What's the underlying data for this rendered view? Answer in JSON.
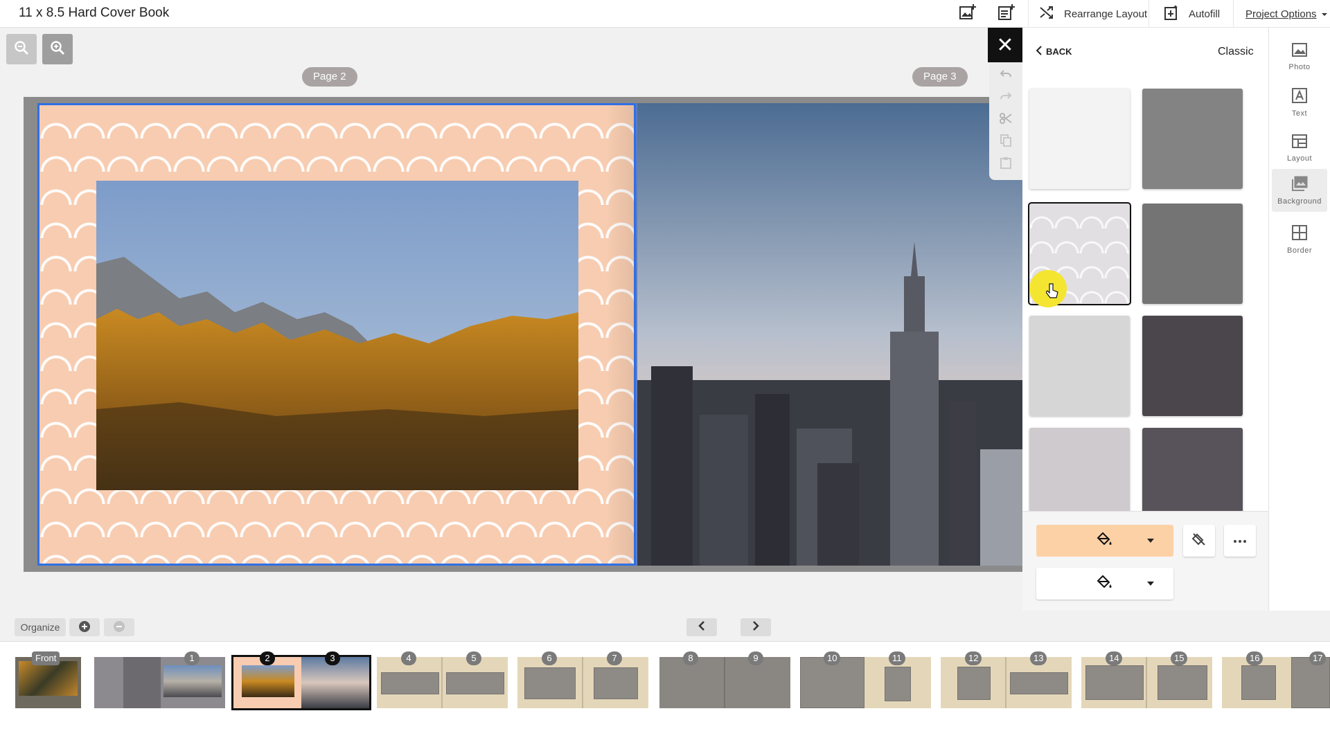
{
  "header": {
    "title": "11 x 8.5 Hard Cover Book",
    "rearrange_label": "Rearrange Layout",
    "autofill_label": "Autofill",
    "project_options_label": "Project Options"
  },
  "canvas": {
    "left_page_label": "Page 2",
    "right_page_label": "Page 3"
  },
  "panel": {
    "back_label": "BACK",
    "title": "Classic",
    "swatches": [
      {
        "color": "#f3f3f3",
        "pattern": "damask-light"
      },
      {
        "color": "#838383",
        "pattern": "damask-grey"
      },
      {
        "color": "#e2dfe2",
        "pattern": "quatrefoil",
        "selected": true
      },
      {
        "color": "#747474",
        "pattern": "damask-grey"
      },
      {
        "color": "#d6d6d6",
        "pattern": "plain-light"
      },
      {
        "color": "#4b464c",
        "pattern": "damask-dark"
      },
      {
        "color": "#cfcacd",
        "pattern": "damask-light"
      },
      {
        "color": "#58525a",
        "pattern": "damask-dark"
      }
    ],
    "fill_color_primary": "#fdd1a6",
    "fill_color_secondary": "#ffffff"
  },
  "sidebar": {
    "items": [
      {
        "label": "Photo",
        "icon": "photo-icon"
      },
      {
        "label": "Text",
        "icon": "text-icon"
      },
      {
        "label": "Layout",
        "icon": "layout-icon"
      },
      {
        "label": "Background",
        "icon": "background-icon",
        "active": true
      },
      {
        "label": "Border",
        "icon": "border-icon"
      }
    ]
  },
  "bottom": {
    "organize_label": "Organize"
  },
  "thumbnails": {
    "front_label": "Front",
    "spreads": [
      {
        "left": "",
        "right": "1"
      },
      {
        "left": "2",
        "right": "3",
        "selected": true
      },
      {
        "left": "4",
        "right": "5"
      },
      {
        "left": "6",
        "right": "7"
      },
      {
        "left": "8",
        "right": "9"
      },
      {
        "left": "10",
        "right": "11"
      },
      {
        "left": "12",
        "right": "13"
      },
      {
        "left": "14",
        "right": "15"
      },
      {
        "left": "16",
        "right": "17"
      }
    ]
  }
}
